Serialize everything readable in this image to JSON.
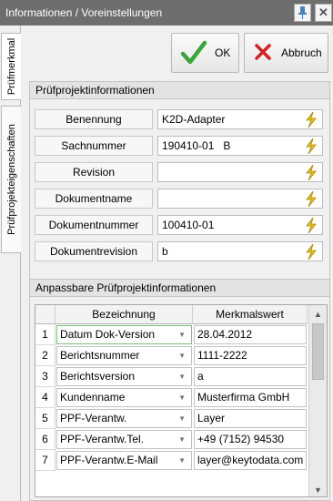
{
  "window": {
    "title": "Informationen / Voreinstellungen",
    "close_symbol": "✕"
  },
  "tabs": [
    {
      "label": "Prüfmerkmal"
    },
    {
      "label": "Prüfprojekteigenschaften"
    }
  ],
  "buttons": {
    "ok_label": "OK",
    "cancel_label": "Abbruch"
  },
  "project_info": {
    "heading": "Prüfprojektinformationen",
    "fields": [
      {
        "label": "Benennung",
        "value": "K2D-Adapter"
      },
      {
        "label": "Sachnummer",
        "value": "190410-01   B"
      },
      {
        "label": "Revision",
        "value": ""
      },
      {
        "label": "Dokumentname",
        "value": ""
      },
      {
        "label": "Dokumentnummer",
        "value": "100410-01"
      },
      {
        "label": "Dokumentrevision",
        "value": "b"
      }
    ]
  },
  "custom_info": {
    "heading": "Anpassbare Prüfprojektinformationen",
    "columns": {
      "designation": "Bezeichnung",
      "value": "Merkmalswert"
    },
    "rows": [
      {
        "num": "1",
        "designation": "Datum Dok-Version",
        "value": "28.04.2012"
      },
      {
        "num": "2",
        "designation": "Berichtsnummer",
        "value": "1111-2222"
      },
      {
        "num": "3",
        "designation": "Berichtsversion",
        "value": "a"
      },
      {
        "num": "4",
        "designation": "Kundenname",
        "value": "Musterfirma GmbH"
      },
      {
        "num": "5",
        "designation": "PPF-Verantw.",
        "value": "Layer"
      },
      {
        "num": "6",
        "designation": "PPF-Verantw.Tel.",
        "value": "+49 (7152) 94530"
      },
      {
        "num": "7",
        "designation": "PPF-Verantw.E-Mail",
        "value": "layer@keytodata.com"
      }
    ]
  },
  "colors": {
    "titlebar": "#6e6e6e",
    "ok_check": "#3aa53a",
    "cancel_x": "#d62020",
    "bolt": "#e8c21a",
    "selected_cell_border": "#7ac07a"
  }
}
